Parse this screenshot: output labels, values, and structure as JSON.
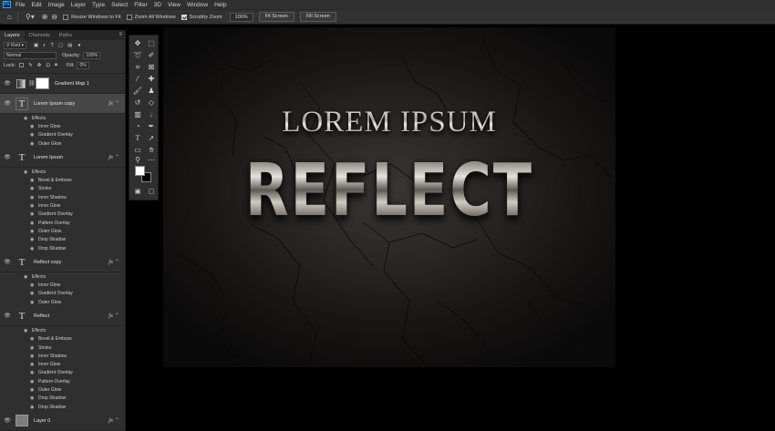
{
  "app": {
    "logo": "Ps",
    "menu": [
      "File",
      "Edit",
      "Image",
      "Layer",
      "Type",
      "Select",
      "Filter",
      "3D",
      "View",
      "Window",
      "Help"
    ]
  },
  "options_bar": {
    "icons": [
      "home-icon",
      "zoom-icon",
      "zoom-in-icon",
      "zoom-out-icon"
    ],
    "resize_windows_label": "Resize Windows to Fit",
    "zoom_all_label": "Zoom All Windows",
    "scrubby_zoom_label": "Scrubby Zoom",
    "scrubby_zoom_checked": true,
    "zoom_value": "100%",
    "fit_screen": "Fit Screen",
    "fill_screen": "Fill Screen"
  },
  "layers_panel": {
    "tabs": [
      "Layers",
      "Channels",
      "Paths"
    ],
    "filter_kind": "Kind",
    "blend_mode": "Normal",
    "opacity_label": "Opacity:",
    "opacity_value": "100%",
    "lock_label": "Lock:",
    "fill_label": "Fill:",
    "fill_value": "0%",
    "effects_label": "Effects",
    "fx_label": "fx",
    "layers": [
      {
        "name": "Gradient Map 1"
      },
      {
        "name": "Lorem Ipsum copy",
        "effects": [
          "Inner Glow",
          "Gradient Overlay",
          "Outer Glow"
        ]
      },
      {
        "name": "Lorem Ipsum",
        "effects": [
          "Bevel & Emboss",
          "Stroke",
          "Inner Shadow",
          "Inner Glow",
          "Gradient Overlay",
          "Pattern Overlay",
          "Outer Glow",
          "Drop Shadow",
          "Drop Shadow"
        ]
      },
      {
        "name": "Reflect copy",
        "effects": [
          "Inner Glow",
          "Gradient Overlay",
          "Outer Glow"
        ]
      },
      {
        "name": "Reflect",
        "effects": [
          "Bevel & Emboss",
          "Stroke",
          "Inner Shadow",
          "Inner Glow",
          "Gradient Overlay",
          "Pattern Overlay",
          "Outer Glow",
          "Drop Shadow",
          "Drop Shadow"
        ]
      },
      {
        "name": "Layer 0"
      }
    ]
  },
  "tools": [
    "move-tool",
    "marquee-tool",
    "lasso-tool",
    "quick-select-tool",
    "crop-tool",
    "frame-tool",
    "eyedropper-tool",
    "healing-tool",
    "brush-tool",
    "stamp-tool",
    "history-brush-tool",
    "eraser-tool",
    "gradient-tool",
    "blur-tool",
    "dodge-tool",
    "pen-tool",
    "type-tool",
    "path-select-tool",
    "rectangle-tool",
    "hand-tool",
    "zoom-tool",
    "more-tools"
  ],
  "canvas": {
    "headline": "LOREM IPSUM",
    "title": "REFLECT",
    "background_color": "#2a2725",
    "text_color": "#b8b3ac"
  }
}
